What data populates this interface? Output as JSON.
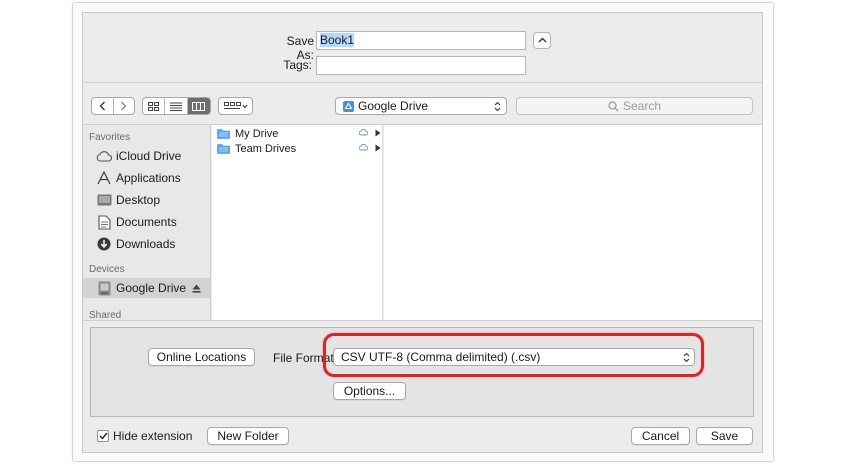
{
  "save_as": {
    "label": "Save As:",
    "value": "Book1",
    "tags_label": "Tags:",
    "tags_value": ""
  },
  "toolbar": {
    "location": "Google Drive",
    "search_placeholder": "Search",
    "view_mode": "columns"
  },
  "sidebar": {
    "favorites_heading": "Favorites",
    "favorites": [
      {
        "label": "iCloud Drive",
        "icon": "cloud-icon"
      },
      {
        "label": "Applications",
        "icon": "applications-icon"
      },
      {
        "label": "Desktop",
        "icon": "desktop-icon"
      },
      {
        "label": "Documents",
        "icon": "documents-icon"
      },
      {
        "label": "Downloads",
        "icon": "downloads-icon"
      }
    ],
    "devices_heading": "Devices",
    "devices": [
      {
        "label": "Google Drive",
        "icon": "drive-disk-icon",
        "selected": true
      }
    ],
    "shared_heading": "Shared"
  },
  "browser": {
    "column1": [
      {
        "label": "My Drive"
      },
      {
        "label": "Team Drives"
      }
    ]
  },
  "accessory": {
    "online_locations": "Online Locations",
    "file_format_label": "File Format:",
    "file_format_value": "CSV UTF-8 (Comma delimited) (.csv)",
    "options": "Options..."
  },
  "footer": {
    "hide_extension_label": "Hide extension",
    "hide_extension_checked": true,
    "new_folder": "New Folder",
    "cancel": "Cancel",
    "save": "Save"
  },
  "colors": {
    "highlight": "#d6262c",
    "folder": "#5aa9e6",
    "selected_sidebar": "#d2d2d2"
  }
}
